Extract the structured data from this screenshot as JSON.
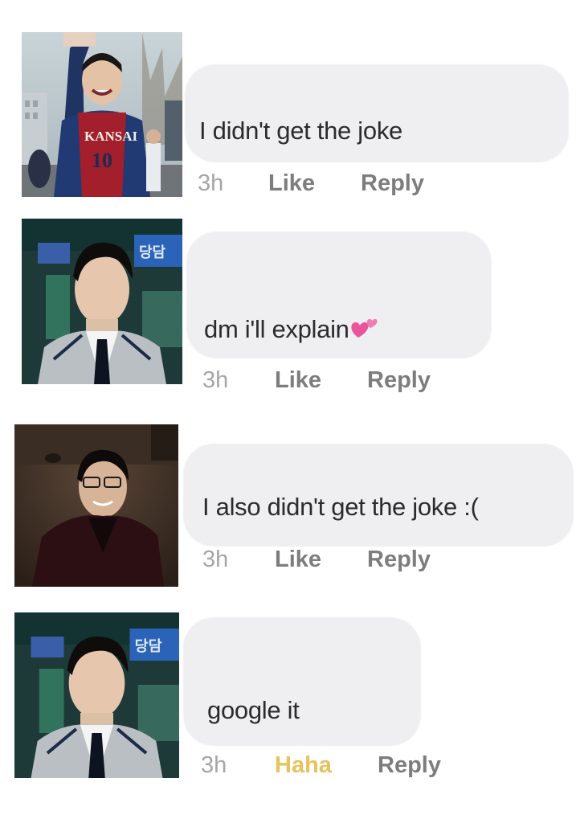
{
  "comments": [
    {
      "avatar_icon": "profile-photo-waving-player",
      "text": "I didn't get the joke",
      "time": "3h",
      "reaction_label": "Like",
      "reply_label": "Reply"
    },
    {
      "avatar_icon": "profile-photo-grey-blazer",
      "text": "dm i'll explain",
      "emoji": "two-hearts-emoji",
      "time": "3h",
      "reaction_label": "Like",
      "reply_label": "Reply"
    },
    {
      "avatar_icon": "profile-photo-glasses-smiling",
      "text": "I also didn't get the joke :(",
      "time": "3h",
      "reaction_label": "Like",
      "reply_label": "Reply"
    },
    {
      "avatar_icon": "profile-photo-grey-blazer",
      "text": "google it",
      "time": "3h",
      "reaction_label": "Haha",
      "reaction_color": "#e7c25e",
      "reply_label": "Reply"
    }
  ],
  "colors": {
    "bubble": "#efeff1",
    "text": "#2b2b2b",
    "action": "#7d7d7d",
    "time": "#a6a6a6",
    "haha": "#e7c25e"
  }
}
